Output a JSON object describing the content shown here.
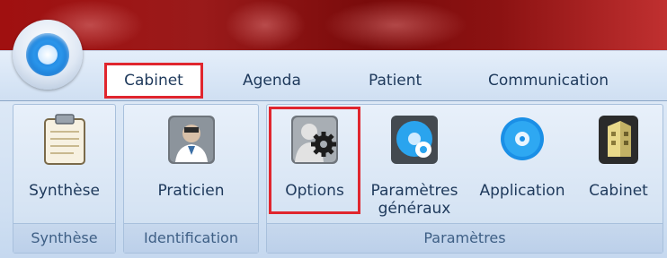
{
  "tabs": {
    "cabinet": "Cabinet",
    "agenda": "Agenda",
    "patient": "Patient",
    "communication": "Communication"
  },
  "groups": {
    "synthese": "Synthèse",
    "identification": "Identification",
    "parametres": "Paramètres"
  },
  "buttons": {
    "synthese": "Synthèse",
    "praticien": "Praticien",
    "options": "Options",
    "parametres_generaux_line1": "Paramètres",
    "parametres_generaux_line2": "généraux",
    "application": "Application",
    "cabinet": "Cabinet"
  },
  "colors": {
    "titlebar": "#9a1a1a",
    "ribbon": "#dce8f6",
    "highlight": "#e0262e",
    "text": "#1e395b"
  }
}
